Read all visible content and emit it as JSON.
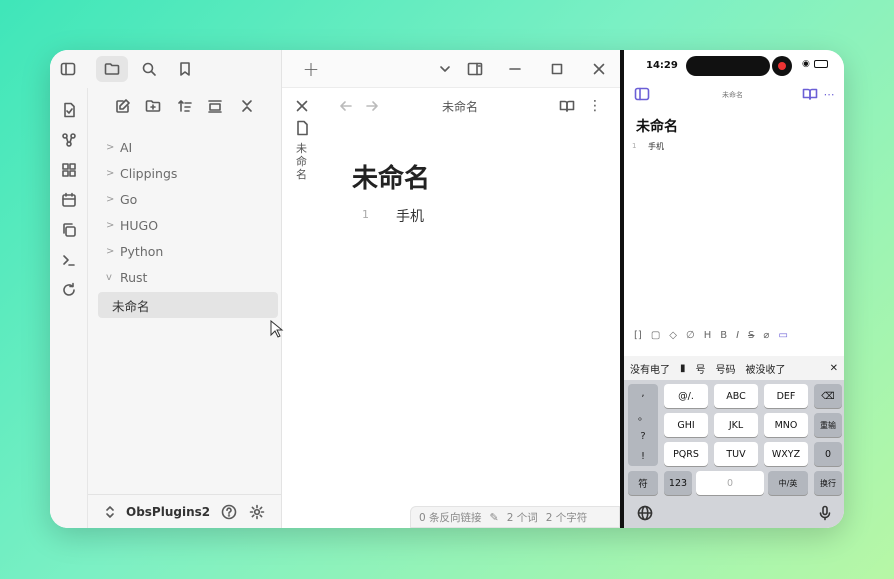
{
  "desktop": {
    "sidebar": {
      "tabs": [
        "files",
        "search",
        "bookmarks"
      ],
      "tree": [
        {
          "label": "AI",
          "type": "folder",
          "expanded": false
        },
        {
          "label": "Clippings",
          "type": "folder",
          "expanded": false
        },
        {
          "label": "Go",
          "type": "folder",
          "expanded": false
        },
        {
          "label": "HUGO",
          "type": "folder",
          "expanded": false
        },
        {
          "label": "Python",
          "type": "folder",
          "expanded": false
        },
        {
          "label": "Rust",
          "type": "folder",
          "expanded": true
        }
      ],
      "active_file": "未命名",
      "vault_name": "ObsPlugins2"
    },
    "editor": {
      "new_tab": "+",
      "view_title": "未命名",
      "vertical_tab_title": "未\n命\n名",
      "doc_title": "未命名",
      "line_number": "1",
      "line_text": "手机",
      "status": {
        "backlinks": "0 条反向链接",
        "words": "2 个词",
        "chars": "2 个字符"
      }
    }
  },
  "phone": {
    "time": "14:29",
    "header_title": "未命名",
    "doc_title": "未命名",
    "line_number": "1",
    "line_text": "手机",
    "format_bar": [
      "[]",
      "H",
      "B",
      "I",
      "S"
    ],
    "candidates": [
      "没有电了",
      "号",
      "号码",
      "被没收了"
    ],
    "keyboard": {
      "left_col": [
        ",",
        "。",
        "?",
        "!"
      ],
      "rows": [
        [
          "@/.",
          "ABC",
          "DEF"
        ],
        [
          "GHI",
          "JKL",
          "MNO"
        ],
        [
          "PQRS",
          "TUV",
          "WXYZ"
        ]
      ],
      "right_col": [
        "重输",
        "0"
      ],
      "bottom": {
        "symbols": "符",
        "numbers": "123",
        "space": "0",
        "lang": "中/英",
        "enter": "换行"
      }
    }
  }
}
